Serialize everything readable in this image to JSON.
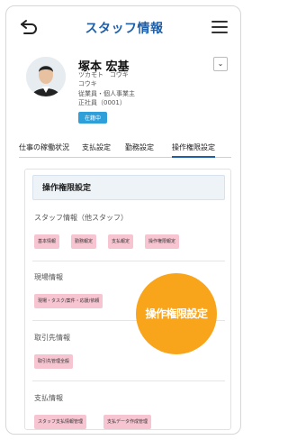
{
  "header": {
    "title": "スタッフ情報"
  },
  "profile": {
    "name": "塚本 宏基",
    "kana_last": "ツカモト　コウキ",
    "kana_first": "コウキ",
    "role": "従業員・個人事業主",
    "code": "正社員（0001）",
    "status": "在籍中"
  },
  "tabs": [
    "仕事の稼働状況",
    "支払設定",
    "勤務設定",
    "操作権限設定"
  ],
  "active_tab": "操作権限設定",
  "section": {
    "title": "操作権限設定"
  },
  "groups": [
    {
      "title": "スタッフ情報（他スタッフ）",
      "chips": [
        "基本情報",
        "勤務報定",
        "支払報定",
        "操作権限報定"
      ]
    },
    {
      "title": "現場情報",
      "chips": [
        "現場・タスク/案件・応援/依頼"
      ]
    },
    {
      "title": "取引先情報",
      "chips": [
        "取引先管理全般"
      ]
    },
    {
      "title": "支払情報",
      "chips": [
        "スタッフ支払情報管理",
        "支払データ作成管理"
      ]
    }
  ],
  "overlay": {
    "label": "操作権限設定"
  },
  "colors": {
    "accent": "#1f5fa8",
    "chip": "#f7c4d1",
    "badge": "#2f9fd9",
    "highlight": "#f8a51b"
  }
}
